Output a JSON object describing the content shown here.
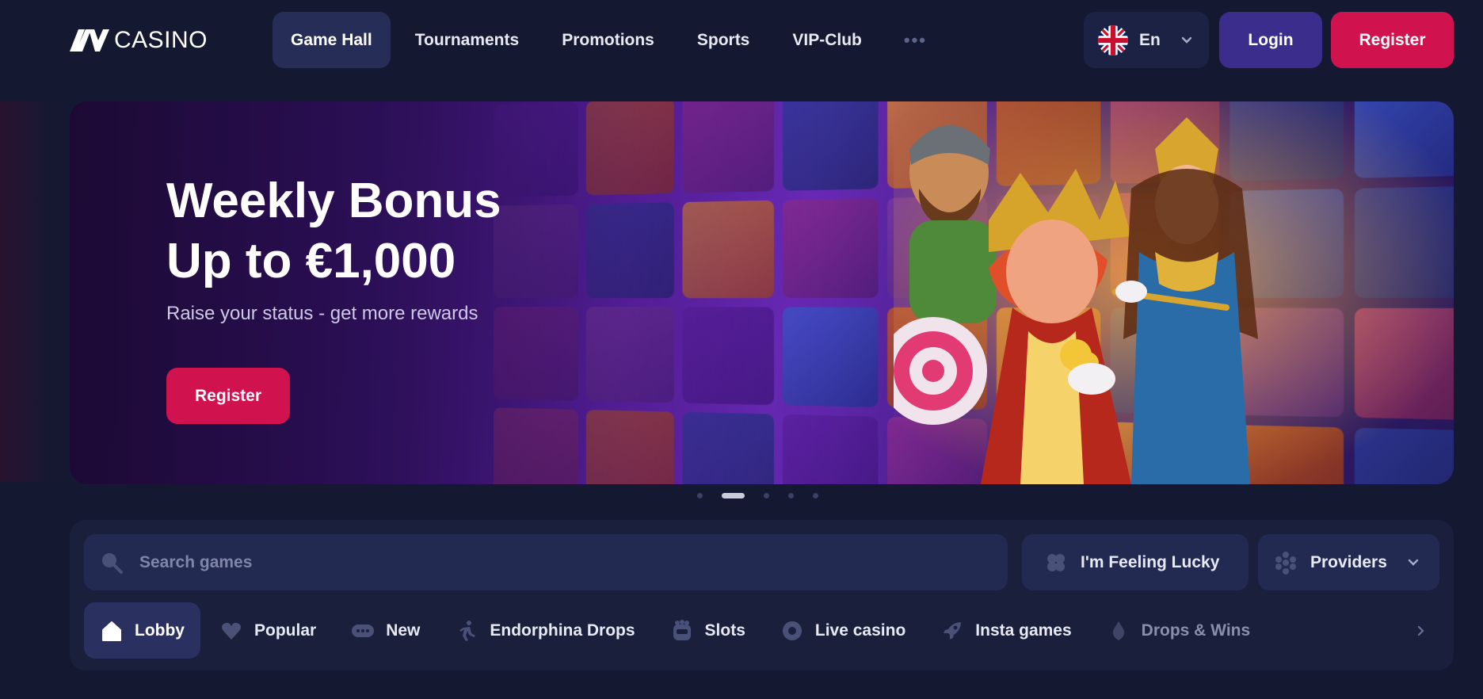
{
  "header": {
    "logo_text": "CASINO",
    "nav": [
      {
        "label": "Game Hall",
        "active": true
      },
      {
        "label": "Tournaments",
        "active": false
      },
      {
        "label": "Promotions",
        "active": false
      },
      {
        "label": "Sports",
        "active": false
      },
      {
        "label": "VIP-Club",
        "active": false
      }
    ],
    "more_label": "•••",
    "language": {
      "label": "En",
      "flag": "uk-flag-icon"
    },
    "login_label": "Login",
    "register_label": "Register"
  },
  "banner": {
    "title_line1": "Weekly Bonus",
    "title_line2": "Up to €1,000",
    "subtitle": "Raise your status - get more rewards",
    "cta_label": "Register"
  },
  "carousel": {
    "slides": 5,
    "active_index": 1
  },
  "search": {
    "placeholder": "Search games",
    "lucky_label": "I'm Feeling Lucky",
    "providers_label": "Providers"
  },
  "categories": [
    {
      "label": "Lobby",
      "icon": "home-icon",
      "active": true
    },
    {
      "label": "Popular",
      "icon": "heart-icon",
      "active": false
    },
    {
      "label": "New",
      "icon": "new-badge-icon",
      "active": false
    },
    {
      "label": "Endorphina Drops",
      "icon": "runner-icon",
      "active": false
    },
    {
      "label": "Slots",
      "icon": "slot-machine-icon",
      "active": false
    },
    {
      "label": "Live casino",
      "icon": "live-icon",
      "active": false
    },
    {
      "label": "Insta games",
      "icon": "rocket-icon",
      "active": false
    },
    {
      "label": "Drops & Wins",
      "icon": "drops-wins-icon",
      "active": false
    }
  ],
  "colors": {
    "background": "#141830",
    "accent_register": "#d0124f",
    "accent_login": "#3b2d8c",
    "panel": "#1a1f3c"
  }
}
